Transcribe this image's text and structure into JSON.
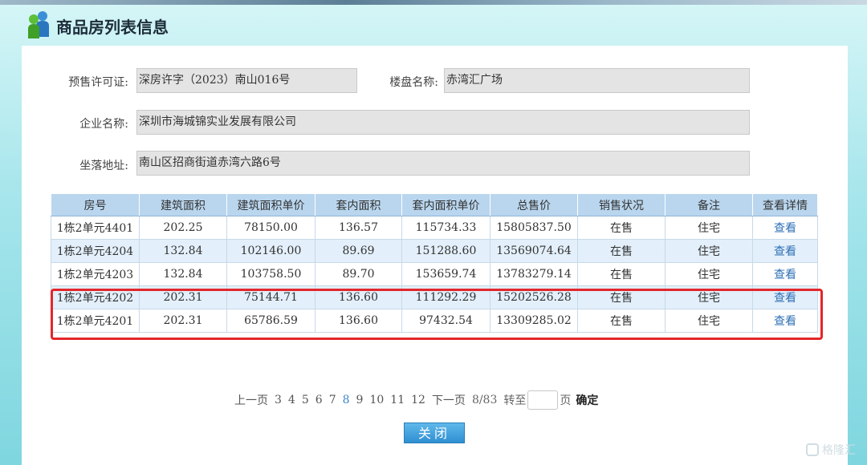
{
  "header": {
    "title": "商品房列表信息"
  },
  "form": {
    "presale_label": "预售许可证:",
    "presale_value": "深房许字（2023）南山016号",
    "project_label": "楼盘名称:",
    "project_value": "赤湾汇广场",
    "company_label": "企业名称:",
    "company_value": "深圳市海城锦实业发展有限公司",
    "address_label": "坐落地址:",
    "address_value": "南山区招商街道赤湾六路6号"
  },
  "table": {
    "headers": [
      "房号",
      "建筑面积",
      "建筑面积单价",
      "套内面积",
      "套内面积单价",
      "总售价",
      "销售状况",
      "备注",
      "查看详情"
    ],
    "rows": [
      [
        "1栋2单元4401",
        "202.25",
        "78150.00",
        "136.57",
        "115734.33",
        "15805837.50",
        "在售",
        "住宅",
        "查看"
      ],
      [
        "1栋2单元4204",
        "132.84",
        "102146.00",
        "89.69",
        "151288.60",
        "13569074.64",
        "在售",
        "住宅",
        "查看"
      ],
      [
        "1栋2单元4203",
        "132.84",
        "103758.50",
        "89.70",
        "153659.74",
        "13783279.14",
        "在售",
        "住宅",
        "查看"
      ],
      [
        "1栋2单元4202",
        "202.31",
        "75144.71",
        "136.60",
        "111292.29",
        "15202526.28",
        "在售",
        "住宅",
        "查看"
      ],
      [
        "1栋2单元4201",
        "202.31",
        "65786.59",
        "136.60",
        "97432.54",
        "13309285.02",
        "在售",
        "住宅",
        "查看"
      ]
    ]
  },
  "pager": {
    "prev": "上一页",
    "pages": [
      "3",
      "4",
      "5",
      "6",
      "7",
      "8",
      "9",
      "10",
      "11",
      "12"
    ],
    "current_page": "8",
    "next": "下一页",
    "status": "8/83",
    "goto": "转至",
    "page_unit": "页",
    "confirm": "确定"
  },
  "close_label": "关闭",
  "watermark": "格隆汇",
  "colors": {
    "highlight": "#e3262a",
    "header_bg": "#b9d6ee",
    "accent": "#2f8fd1"
  }
}
